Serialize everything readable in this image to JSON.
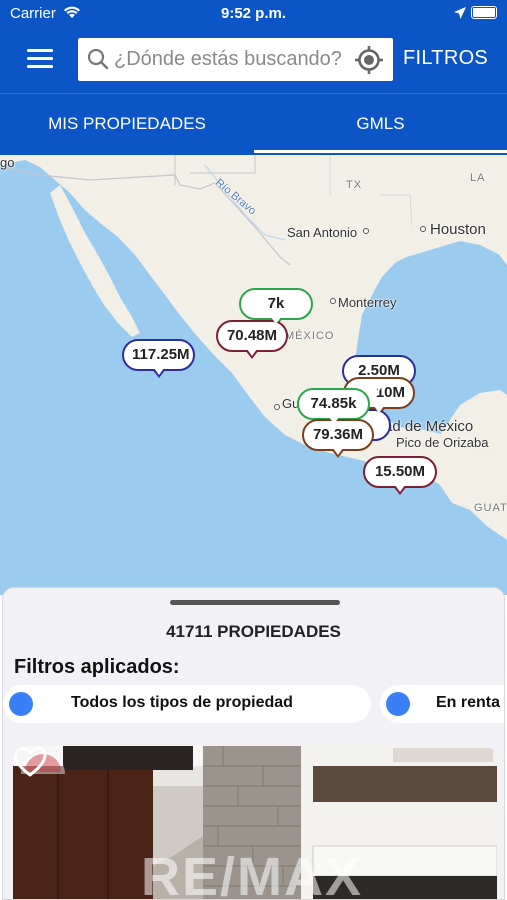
{
  "status_bar": {
    "carrier": "Carrier",
    "time": "9:52 p.m."
  },
  "header": {
    "search_placeholder": "¿Dónde estás buscando?",
    "filters_label": "FILTROS",
    "brand_color": "#0b55c6"
  },
  "tabs": [
    {
      "label": "MIS PROPIEDADES",
      "selected": false
    },
    {
      "label": "GMLS",
      "selected": true
    }
  ],
  "map": {
    "labels": {
      "tx": "TX",
      "la": "LA",
      "rio_bravo": "Río Bravo",
      "san_antonio": "San Antonio",
      "houston": "Houston",
      "monterrey": "Monterrey",
      "mexico": "MÉXICO",
      "gu": "Gu",
      "cdmx": "ad de México",
      "pico": "Pico de Orizaba",
      "guat": "GUAT",
      "go": "go"
    },
    "pins": [
      {
        "label": "7k",
        "color": "green"
      },
      {
        "label": "70.48M",
        "color": "maroon"
      },
      {
        "label": "117.25M",
        "color": "blue"
      },
      {
        "label": "2.50M",
        "color": "blue"
      },
      {
        "label": "10M",
        "color": "brown"
      },
      {
        "label": "74.85k",
        "color": "green"
      },
      {
        "label": "79.36M",
        "color": "brown"
      },
      {
        "label": "15.50M",
        "color": "maroon"
      }
    ]
  },
  "sheet": {
    "count_label": "41711 PROPIEDADES",
    "filters_title": "Filtros aplicados:",
    "chips": [
      {
        "label": "Todos los tipos de propiedad"
      },
      {
        "label": "En renta"
      }
    ],
    "card": {
      "favorite_icon": "heart-icon",
      "watermark": "RE/MAX"
    }
  }
}
